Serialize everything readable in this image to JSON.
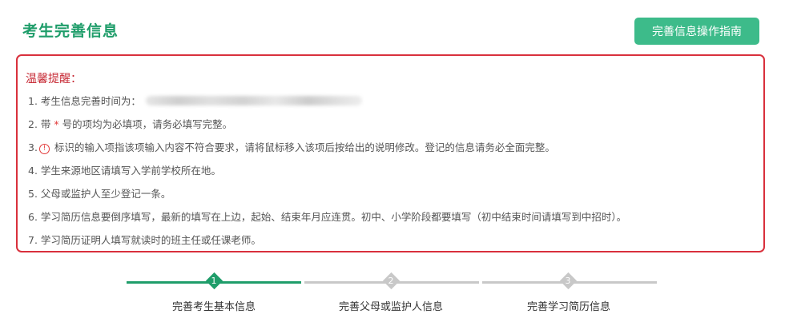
{
  "header": {
    "title": "考生完善信息",
    "guide_button": "完善信息操作指南"
  },
  "notice": {
    "title": "温馨提醒：",
    "items": [
      {
        "num": "1.",
        "text": "考生信息完善时间为："
      },
      {
        "num": "2.",
        "pre": "带",
        "star": "*",
        "text": "号的项均为必填项，请务必填写完整。"
      },
      {
        "num": "3.",
        "icon": "!",
        "text": "标识的输入项指该项输入内容不符合要求，请将鼠标移入该项后按给出的说明修改。登记的信息请务必全面完整。"
      },
      {
        "num": "4.",
        "text": "学生来源地区请填写入学前学校所在地。"
      },
      {
        "num": "5.",
        "text": "父母或监护人至少登记一条。"
      },
      {
        "num": "6.",
        "text": "学习简历信息要倒序填写，最新的填写在上边，起始、结束年月应连贯。初中、小学阶段都要填写（初中结束时间请填写到中招时）。"
      },
      {
        "num": "7.",
        "text": "学习简历证明人填写就读时的班主任或任课老师。"
      }
    ]
  },
  "steps": [
    {
      "number": "1",
      "label": "完善考生基本信息",
      "active": true
    },
    {
      "number": "2",
      "label": "完善父母或监护人信息",
      "active": false
    },
    {
      "number": "3",
      "label": "完善学习简历信息",
      "active": false
    }
  ],
  "colors": {
    "brand_green": "#1f9d6a",
    "button_green": "#3dbb8a",
    "alert_red": "#d9303c",
    "inactive_gray": "#c8c8c8"
  }
}
